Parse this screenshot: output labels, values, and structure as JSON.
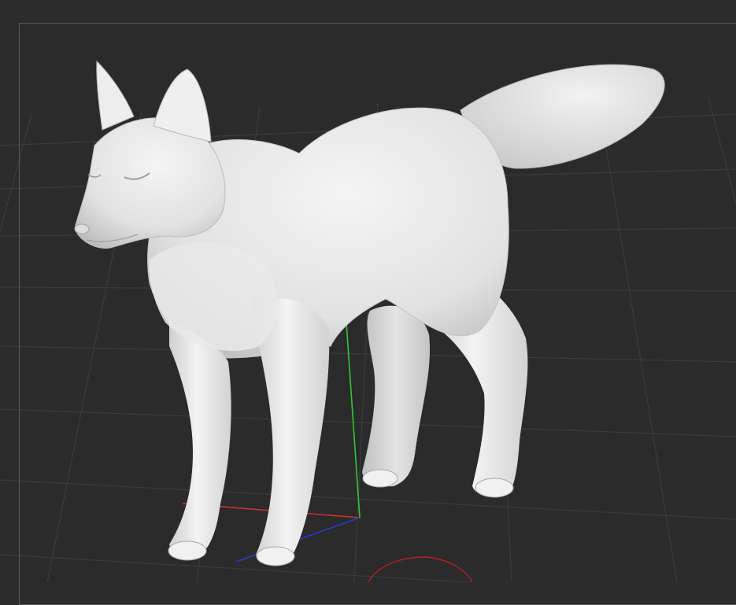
{
  "app": {
    "name": "",
    "view": "perspective"
  },
  "viewport": {
    "background": "#2b2b2b",
    "frame_color": "#5a5a5a",
    "grid_color": "#3a3a3a",
    "grid": true
  },
  "axes": {
    "x_color": "#c8332f",
    "y_color": "#36c43a",
    "z_color": "#2a3acb"
  },
  "model": {
    "subject": "fox sculpt",
    "material_color": "#ececec",
    "shading": "matcap"
  },
  "gizmo": {
    "rotation_ring_color": "#b51f22"
  }
}
